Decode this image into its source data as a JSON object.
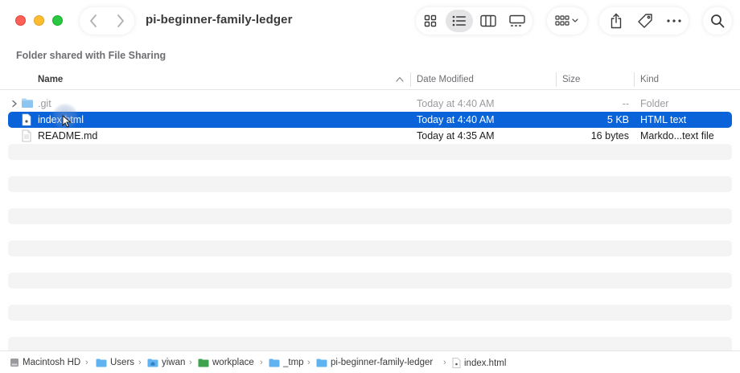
{
  "window": {
    "title": "pi-beginner-family-ledger",
    "shared_label": "Folder shared with File Sharing"
  },
  "toolbar": {
    "nav": [
      "chevron-left-icon",
      "chevron-right-icon"
    ],
    "view_modes": [
      "icon-grid",
      "list",
      "columns",
      "gallery"
    ],
    "active_view": "list",
    "actions": [
      "share-icon",
      "tag-icon",
      "more-icon"
    ]
  },
  "columns": {
    "name": "Name",
    "date": "Date Modified",
    "size": "Size",
    "kind": "Kind"
  },
  "files": [
    {
      "name": ".git",
      "date": "Today at 4:40 AM",
      "size": "--",
      "kind": "Folder",
      "type": "folder",
      "hidden": true,
      "selected": false
    },
    {
      "name": "index.html",
      "date": "Today at 4:40 AM",
      "size": "5 KB",
      "kind": "HTML text",
      "type": "html",
      "hidden": false,
      "selected": true
    },
    {
      "name": "README.md",
      "date": "Today at 4:35 AM",
      "size": "16 bytes",
      "kind": "Markdo...text file",
      "type": "text",
      "hidden": false,
      "selected": false
    }
  ],
  "path": [
    {
      "label": "Macintosh HD",
      "icon": "disk-icon"
    },
    {
      "label": "Users",
      "icon": "folder-icon"
    },
    {
      "label": "yiwan",
      "icon": "home-folder-icon"
    },
    {
      "label": "workplace",
      "icon": "green-folder-icon"
    },
    {
      "label": "_tmp",
      "icon": "folder-icon"
    },
    {
      "label": "pi-beginner-family-ledger",
      "icon": "folder-icon"
    },
    {
      "label": "index.html",
      "icon": "html-file-icon"
    }
  ],
  "colors": {
    "selection": "#0a63d8",
    "folder": "#5eb3f0",
    "close": "#fe5f57",
    "minimize": "#febc2e",
    "zoom": "#28c840"
  }
}
